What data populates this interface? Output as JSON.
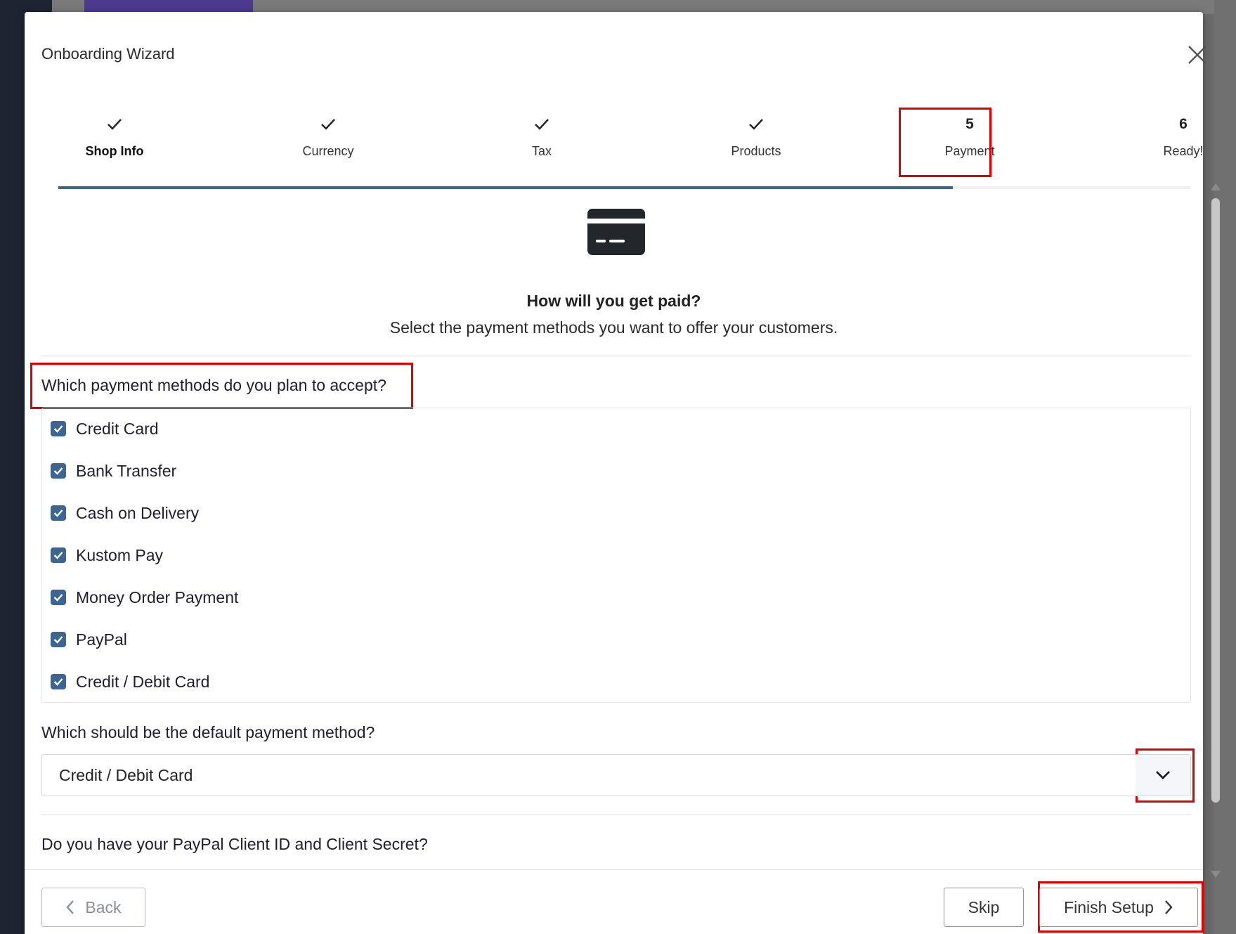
{
  "modal": {
    "title": "Onboarding Wizard"
  },
  "stepper": {
    "steps": [
      {
        "marker": "",
        "label": "Shop Info",
        "state": "done"
      },
      {
        "marker": "",
        "label": "Currency",
        "state": "done"
      },
      {
        "marker": "",
        "label": "Tax",
        "state": "done"
      },
      {
        "marker": "",
        "label": "Products",
        "state": "done"
      },
      {
        "marker": "5",
        "label": "Payment",
        "state": "current"
      },
      {
        "marker": "6",
        "label": "Ready!",
        "state": "upcoming"
      }
    ],
    "progress_fraction": 0.79
  },
  "hero": {
    "icon": "credit-card-icon",
    "title": "How will you get paid?",
    "subtitle": "Select the payment methods you want to offer your customers."
  },
  "payment_methods": {
    "question": "Which payment methods do you plan to accept?",
    "items": [
      {
        "label": "Credit Card",
        "checked": true
      },
      {
        "label": "Bank Transfer",
        "checked": true
      },
      {
        "label": "Cash on Delivery",
        "checked": true
      },
      {
        "label": "Kustom Pay",
        "checked": true
      },
      {
        "label": "Money Order Payment",
        "checked": true
      },
      {
        "label": "PayPal",
        "checked": true
      },
      {
        "label": "Credit / Debit Card",
        "checked": true
      }
    ]
  },
  "default_method": {
    "question": "Which should be the default payment method?",
    "selected": "Credit / Debit Card"
  },
  "paypal": {
    "question": "Do you have your PayPal Client ID and Client Secret?"
  },
  "footer": {
    "back_label": "Back",
    "skip_label": "Skip",
    "finish_label": "Finish Setup"
  },
  "colors": {
    "accent": "#3d6591",
    "highlight": "#e00000"
  }
}
